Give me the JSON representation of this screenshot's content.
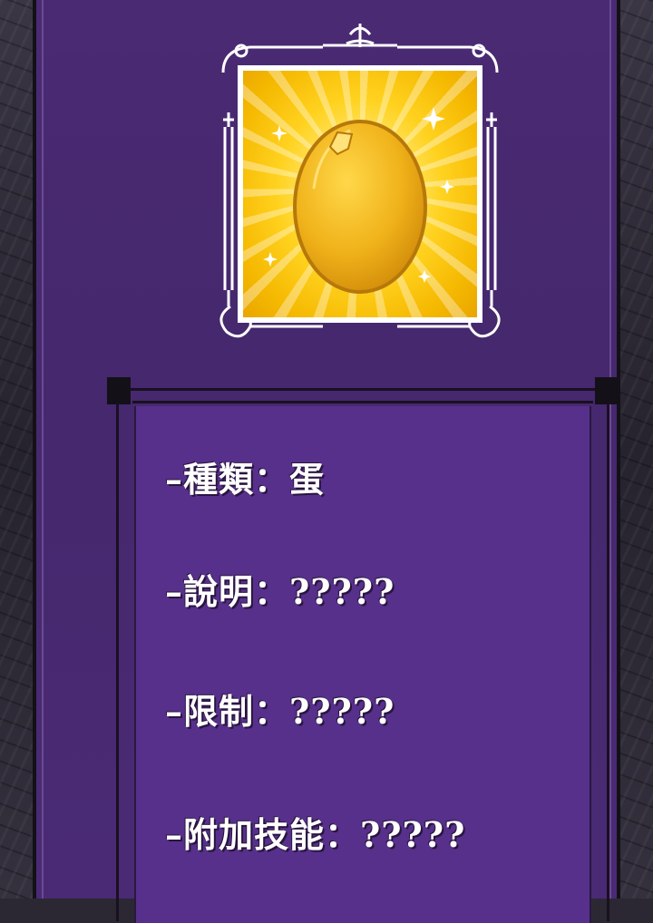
{
  "item": {
    "icon": "golden-egg-icon",
    "frame_color": "#ffffff",
    "glow_color": "#ffd21f"
  },
  "stats": [
    {
      "text": "–種類：蛋"
    },
    {
      "text": "–說明：?????"
    },
    {
      "text": "–限制：?????"
    },
    {
      "text": "–附加技能：?????"
    }
  ],
  "colors": {
    "window_background": "#45286d",
    "panel_background": "#56308a",
    "text": "#ffffff"
  }
}
